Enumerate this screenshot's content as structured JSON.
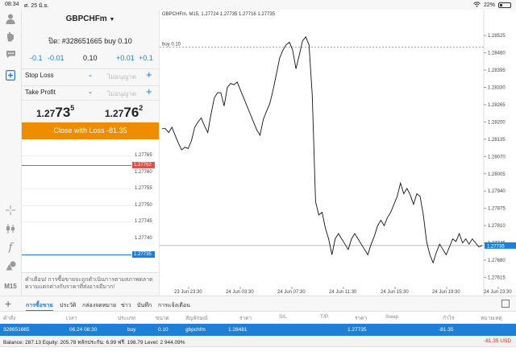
{
  "status_bar": {
    "time": "08:34",
    "date": "ศ. 25 มิ.ย.",
    "battery": "22%"
  },
  "toolbar": {
    "icons": [
      "person-icon",
      "hand-icon",
      "chat-icon",
      "new-order-icon",
      "crosshair-icon",
      "candles-icon",
      "function-icon",
      "objects-icon"
    ],
    "timeframe": "M15"
  },
  "order": {
    "symbol": "GBPCHFm",
    "ticket": "ปิด: #328651665 buy 0.10",
    "volume": {
      "minus_big": "-0.1",
      "minus_small": "-0.01",
      "value": "0.10",
      "plus_small": "+0.01",
      "plus_big": "+0.1"
    },
    "stop_loss": {
      "label": "Stop Loss",
      "minus": "-",
      "value": "ไม่อนุญาต",
      "plus": "+"
    },
    "take_profit": {
      "label": "Take Profit",
      "minus": "-",
      "value": "ไม่อนุญาต",
      "plus": "+"
    },
    "bid": {
      "prefix": "1.27",
      "big": "73",
      "small": "5"
    },
    "ask": {
      "prefix": "1.27",
      "big": "76",
      "small": "2"
    },
    "close_button": "Close with Loss -81.35"
  },
  "mini_chart": {
    "levels": [
      "1.27765",
      "1.27760",
      "1.27755",
      "1.27750",
      "1.27745",
      "1.27740"
    ],
    "ask_tag": "1.27762",
    "bid_tag": "1.27735",
    "ask_color": "#e05050",
    "bid_color": "#1e7fd6"
  },
  "warning": "คำเตือน! การซื้อขายจะถูกดำเนินการตามสภาพตลาด ความแตกต่างกับราคาที่ส่งอาจมีมาก!",
  "main_chart": {
    "header": "GBPCHFm, M15, 1.27724 1.27735 1.27716 1.27735",
    "order_line_label": "buy 0.10",
    "price_labels": [
      "1.28525",
      "1.28460",
      "1.28395",
      "1.28330",
      "1.28265",
      "1.28200",
      "1.28135",
      "1.28070",
      "1.28005",
      "1.27940",
      "1.27875",
      "1.27810",
      "1.27745",
      "1.27680",
      "1.27615"
    ],
    "current_price": "1.27735",
    "time_labels": [
      "23 Jun 23:30",
      "24 Jun 03:30",
      "24 Jun 07:30",
      "24 Jun 11:30",
      "24 Jun 15:30",
      "24 Jun 19:30",
      "24 Jun 23:30"
    ]
  },
  "chart_data": {
    "type": "line",
    "title": "GBPCHFm, M15, 1.27724 1.27735 1.27716 1.27735",
    "x": [
      "23 Jun 23:30",
      "24 Jun 03:30",
      "24 Jun 07:30",
      "24 Jun 11:30",
      "24 Jun 15:30",
      "24 Jun 19:30",
      "24 Jun 23:30"
    ],
    "series": [
      {
        "values": [
          1.28175,
          1.28175,
          1.2816,
          1.2818,
          1.2815,
          1.2812,
          1.28095,
          1.28105,
          1.281,
          1.2813,
          1.2818,
          1.282,
          1.28215,
          1.28185,
          1.2816,
          1.2823,
          1.2829,
          1.2831,
          1.2831,
          1.2826,
          1.2833,
          1.28345,
          1.2834,
          1.2835,
          1.2832,
          1.2829,
          1.2826,
          1.2823,
          1.282,
          1.2817,
          1.2815,
          1.2821,
          1.2824,
          1.2827,
          1.2832,
          1.2838,
          1.2844,
          1.2847,
          1.2849,
          1.285,
          1.2847,
          1.284,
          1.2845,
          1.28505,
          1.2852,
          1.2849,
          1.283,
          1.279,
          1.2785,
          1.2786,
          1.278,
          1.2776,
          1.277,
          1.2776,
          1.2778,
          1.2776,
          1.2774,
          1.2772,
          1.2776,
          1.2778,
          1.2776,
          1.2774,
          1.2772,
          1.277,
          1.2774,
          1.2777,
          1.2781,
          1.2783,
          1.2781,
          1.2784,
          1.2786,
          1.2789,
          1.2792,
          1.2797,
          1.2793,
          1.2795,
          1.27925,
          1.2789,
          1.2793,
          1.2792,
          1.2785,
          1.2775,
          1.277,
          1.2767,
          1.2771,
          1.2774,
          1.2772,
          1.277,
          1.2773,
          1.2776,
          1.2775,
          1.2778,
          1.27745,
          1.2776,
          1.2774,
          1.2776,
          1.27745,
          1.2773,
          1.27735
        ]
      }
    ],
    "annotations": [
      "buy 0.10"
    ],
    "ylim": [
      1.2758,
      1.2858
    ],
    "grid": false
  },
  "trades": {
    "tab_add": "+",
    "tabs": [
      "การซื้อขาย",
      "ประวัติ",
      "กล่องจดหมาย",
      "ข่าว",
      "บันทึก",
      "การแจ้งเตือน"
    ],
    "headers": [
      "คำสั่ง",
      "เวลา",
      "ประเภท",
      "ขนาด",
      "สัญลักษณ์",
      "ราคา",
      "S/L",
      "T/P",
      "ราคา",
      "Swap",
      "กำไร",
      "หมายเหตุ"
    ],
    "row": [
      "328651665",
      "06.24 08:30",
      "buy",
      "0.10",
      "gbpchfm",
      "1.28481",
      "",
      "",
      "1.27735",
      "",
      "-81.35",
      ""
    ],
    "balance_text": "Balance: 287.13 Equity: 205.78 หลักประกัน: 6.99 ฟรี: 198.79 Level: 2 944.09%",
    "balance_profit": "-81.35  USD"
  }
}
